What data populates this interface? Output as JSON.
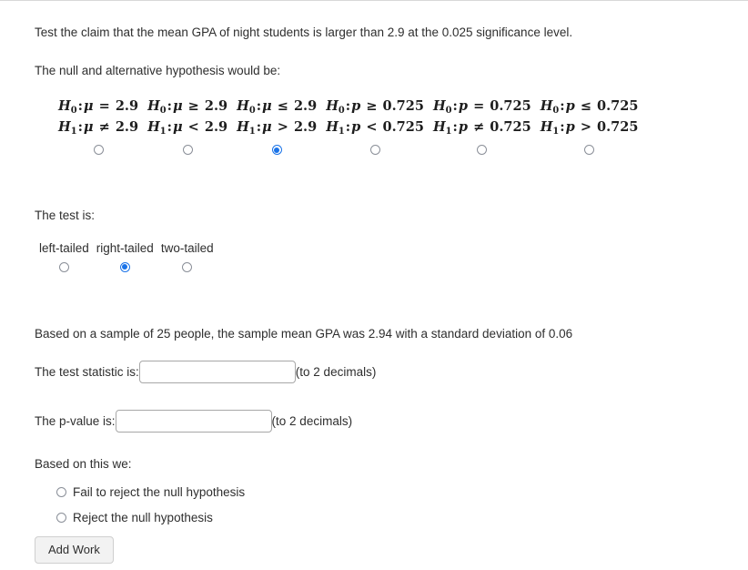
{
  "question": {
    "prompt": "Test the claim that the mean GPA of night students is larger than 2.9 at the 0.025 significance level.",
    "hypothesis_intro": "The null and alternative hypothesis would be:"
  },
  "hypothesis_options": [
    {
      "null_param": "μ",
      "null_op": "=",
      "null_value": "2.9",
      "alt_param": "μ",
      "alt_op": "≠",
      "alt_value": "2.9",
      "selected": false
    },
    {
      "null_param": "μ",
      "null_op": "≥",
      "null_value": "2.9",
      "alt_param": "μ",
      "alt_op": "<",
      "alt_value": "2.9",
      "selected": false
    },
    {
      "null_param": "μ",
      "null_op": "≤",
      "null_value": "2.9",
      "alt_param": "μ",
      "alt_op": ">",
      "alt_value": "2.9",
      "selected": true
    },
    {
      "null_param": "p",
      "null_op": "≥",
      "null_value": "0.725",
      "alt_param": "p",
      "alt_op": "<",
      "alt_value": "0.725",
      "selected": false
    },
    {
      "null_param": "p",
      "null_op": "=",
      "null_value": "0.725",
      "alt_param": "p",
      "alt_op": "≠",
      "alt_value": "0.725",
      "selected": false
    },
    {
      "null_param": "p",
      "null_op": "≤",
      "null_value": "0.725",
      "alt_param": "p",
      "alt_op": ">",
      "alt_value": "0.725",
      "selected": false
    }
  ],
  "hypothesis_notation": {
    "null_symbol": "H",
    "null_subscript": "0",
    "alt_symbol": "H",
    "alt_subscript": "1",
    "colon": ":"
  },
  "test_type": {
    "label": "The test is:",
    "options": [
      {
        "label": "left-tailed",
        "selected": false
      },
      {
        "label": "right-tailed",
        "selected": true
      },
      {
        "label": "two-tailed",
        "selected": false
      }
    ]
  },
  "sample": {
    "text": "Based on a sample of 25 people, the sample mean GPA was 2.94 with a standard deviation of 0.06"
  },
  "answers": {
    "test_statistic": {
      "label": "The test statistic is:",
      "value": "",
      "placeholder": "",
      "hint": "(to 2 decimals)"
    },
    "p_value": {
      "label": "The p-value is:",
      "value": "",
      "placeholder": "",
      "hint": "(to 2 decimals)"
    }
  },
  "conclusion": {
    "label": "Based on this we:",
    "options": [
      {
        "label": "Fail to reject the null hypothesis",
        "selected": false
      },
      {
        "label": "Reject the null hypothesis",
        "selected": false
      }
    ]
  },
  "actions": {
    "add_work_label": "Add Work"
  },
  "colors": {
    "accent": "#1a73e8",
    "text": "#2e2e2e",
    "border": "#a7a7a7",
    "button_bg": "#f2f2f2"
  }
}
